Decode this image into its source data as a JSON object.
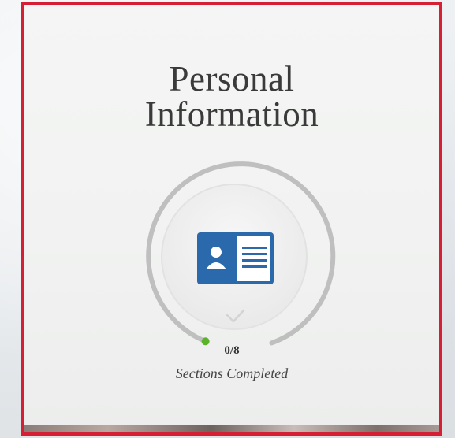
{
  "card": {
    "title_line1": "Personal",
    "title_line2": "Information",
    "accent_color": "#d51f35",
    "icon": "id-card-icon",
    "status_icon": "checkmark-icon"
  },
  "progress": {
    "completed": 0,
    "total": 8,
    "count_label": "0/8",
    "caption": "Sections Completed",
    "indicator_color": "#5cb32b"
  }
}
